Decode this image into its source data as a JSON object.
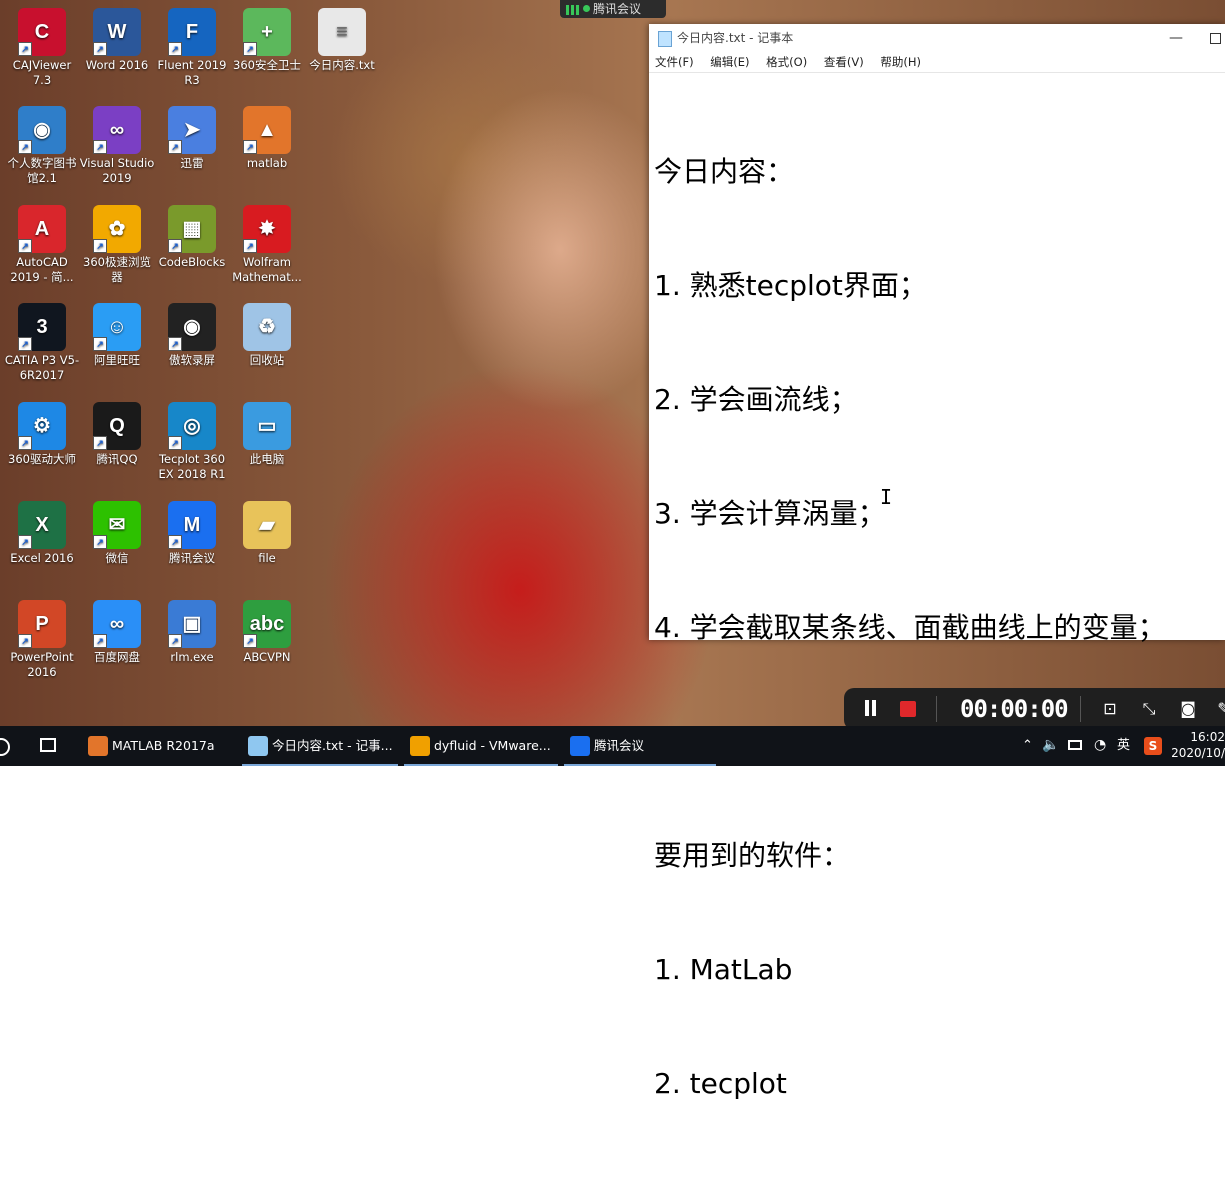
{
  "desktop_icons": [
    {
      "label": "CAJViewer 7.3",
      "color": "#c8102e",
      "glyph": "C"
    },
    {
      "label": "Word 2016",
      "color": "#2b579a",
      "glyph": "W"
    },
    {
      "label": "Fluent 2019 R3",
      "color": "#1565c0",
      "glyph": "F"
    },
    {
      "label": "360安全卫士",
      "color": "#5cb85c",
      "glyph": "+"
    },
    {
      "label": "今日内容.txt",
      "color": "#e8e8e8",
      "glyph": "≡"
    },
    {
      "label": "个人数字图书馆2.1",
      "color": "#2f7ec9",
      "glyph": "◉"
    },
    {
      "label": "Visual Studio 2019",
      "color": "#7b3fc4",
      "glyph": "∞"
    },
    {
      "label": "迅雷",
      "color": "#4a7fe0",
      "glyph": "➤"
    },
    {
      "label": "matlab",
      "color": "#e2752b",
      "glyph": "▲"
    },
    {
      "label": "AutoCAD 2019 - 简...",
      "color": "#d9262c",
      "glyph": "A"
    },
    {
      "label": "360极速浏览器",
      "color": "#f2a900",
      "glyph": "✿"
    },
    {
      "label": "CodeBlocks",
      "color": "#7a9a2b",
      "glyph": "▦"
    },
    {
      "label": "Wolfram Mathemat...",
      "color": "#d81b20",
      "glyph": "✸"
    },
    {
      "label": "CATIA P3 V5-6R2017",
      "color": "#10161f",
      "glyph": "3"
    },
    {
      "label": "阿里旺旺",
      "color": "#2a9df4",
      "glyph": "☺"
    },
    {
      "label": "傲软录屏",
      "color": "#222222",
      "glyph": "◉"
    },
    {
      "label": "回收站",
      "color": "#9fc4e6",
      "glyph": "♻"
    },
    {
      "label": "360驱动大师",
      "color": "#1e88e5",
      "glyph": "⚙"
    },
    {
      "label": "腾讯QQ",
      "color": "#1a1a1a",
      "glyph": "Q"
    },
    {
      "label": "Tecplot 360 EX 2018 R1",
      "color": "#1787c9",
      "glyph": "◎"
    },
    {
      "label": "此电脑",
      "color": "#3a9be0",
      "glyph": "▭"
    },
    {
      "label": "Excel 2016",
      "color": "#1e7145",
      "glyph": "X"
    },
    {
      "label": "微信",
      "color": "#2dc100",
      "glyph": "✉"
    },
    {
      "label": "腾讯会议",
      "color": "#1a6ff0",
      "glyph": "M"
    },
    {
      "label": "file",
      "color": "#e8c35a",
      "glyph": "▰"
    },
    {
      "label": "PowerPoint 2016",
      "color": "#d24726",
      "glyph": "P"
    },
    {
      "label": "百度网盘",
      "color": "#2a8ff7",
      "glyph": "∞"
    },
    {
      "label": "rlm.exe",
      "color": "#3a7bd5",
      "glyph": "▣"
    },
    {
      "label": "ABCVPN",
      "color": "#2e9e3f",
      "glyph": "abc"
    }
  ],
  "meeting_pill": {
    "label": "腾讯会议"
  },
  "notepad": {
    "title": "今日内容.txt - 记事本",
    "menu": [
      "文件(F)",
      "编辑(E)",
      "格式(O)",
      "查看(V)",
      "帮助(H)"
    ],
    "lines": [
      "今日内容：",
      "1. 熟悉tecplot界面；",
      "2. 学会画流线；",
      "3. 学会计算涡量；",
      "4. 学会截取某条线、面截曲线上的变量；",
      "",
      "要用到的软件：",
      "1. MatLab",
      "2. tecplot"
    ]
  },
  "recorder": {
    "time": "00:00:00"
  },
  "taskbar": {
    "items": [
      {
        "label": "MATLAB R2017a",
        "color": "#e2752b"
      },
      {
        "label": "今日内容.txt - 记事...",
        "color": "#8fc7f0"
      },
      {
        "label": "dyfluid - VMware...",
        "color": "#f0a000"
      },
      {
        "label": "腾讯会议",
        "color": "#1a6ff0"
      }
    ],
    "tray_ime": "英",
    "tray_s": "S",
    "clock_time": "16:02",
    "clock_date": "2020/10/"
  }
}
